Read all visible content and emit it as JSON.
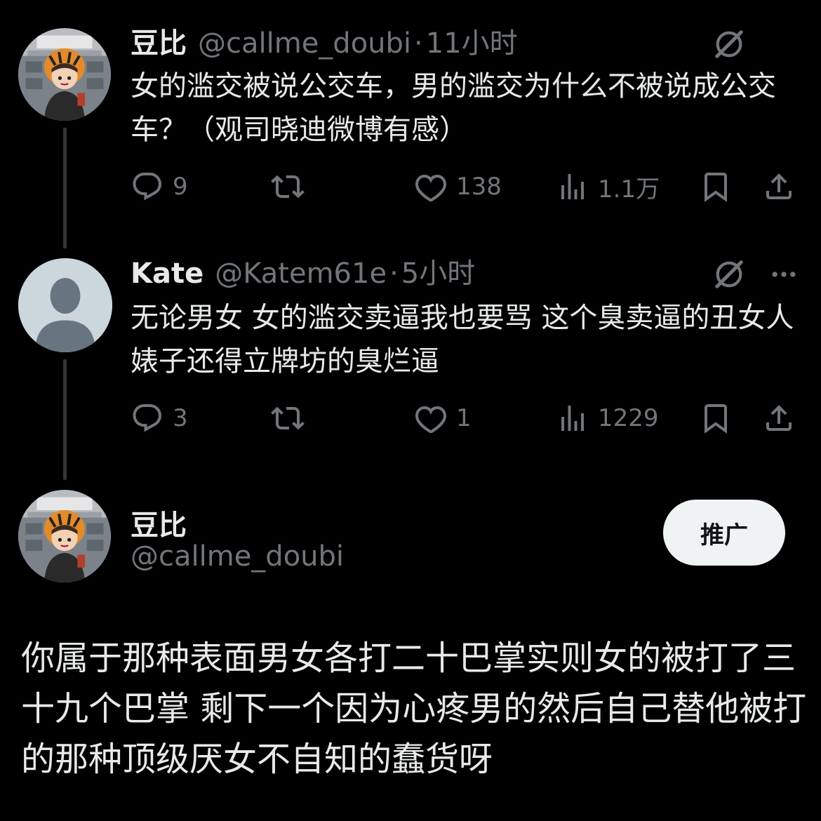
{
  "tweet1": {
    "name": "豆比",
    "handle": "@callme_doubi",
    "dot": "·",
    "time": "11小时",
    "text": "女的滥交被说公交车，男的滥交为什么不被说成公交车？（观司晓迪微博有感）",
    "replies": "9",
    "retweets": "",
    "likes": "138",
    "views": "1.1万"
  },
  "tweet2": {
    "name": "Kate",
    "handle": "@Katem61e",
    "dot": "·",
    "time": "5小时",
    "text": "无论男女 女的滥交卖逼我也要骂 这个臭卖逼的丑女人 婊子还得立牌坊的臭烂逼",
    "replies": "3",
    "retweets": "",
    "likes": "1",
    "views": "1229"
  },
  "tweet3": {
    "name": "豆比",
    "handle": "@callme_doubi",
    "promote_label": "推广",
    "text": "你属于那种表面男女各打二十巴掌实则女的被打了三十九个巴掌 剩下一个因为心疼男的然后自己替他被打的那种顶级厌女不自知的蠢货呀"
  },
  "icons": {
    "reply": "reply-icon",
    "retweet": "retweet-icon",
    "like": "heart-icon",
    "views": "views-icon",
    "bookmark": "bookmark-icon",
    "share": "share-icon",
    "grok": "grok-icon",
    "more": "more-icon"
  },
  "colors": {
    "background": "#000000",
    "text": "#e7e9ea",
    "muted": "#71767b",
    "thread_line": "#333639",
    "button_bg": "#eff3f4"
  }
}
